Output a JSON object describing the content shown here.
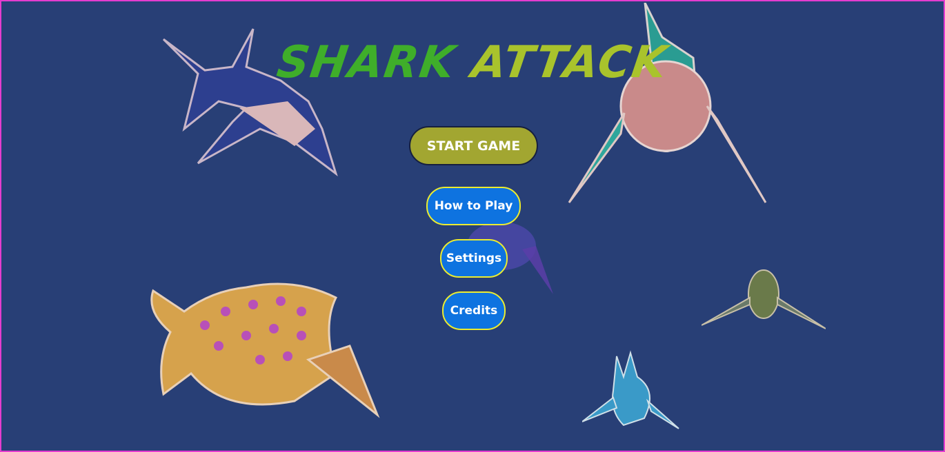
{
  "game": {
    "title_word1": "SHARK",
    "title_word2": "ATTACK"
  },
  "menu": {
    "start_label": "START GAME",
    "howto_label": "How to Play",
    "settings_label": "Settings",
    "credits_label": "Credits"
  },
  "colors": {
    "background": "#283f76",
    "border": "#e43ccf",
    "title_green": "#3fae2a",
    "title_yellow": "#a9c32c",
    "start_button": "#a2a631",
    "menu_button": "#0e73e0",
    "menu_button_border": "#ecec2f"
  },
  "sprites": [
    "swordfish-sprite",
    "whale-shark-sprite",
    "pufferfish-sprite",
    "turtle-sprite",
    "small-fish-sprite",
    "blue-shark-sprite"
  ]
}
